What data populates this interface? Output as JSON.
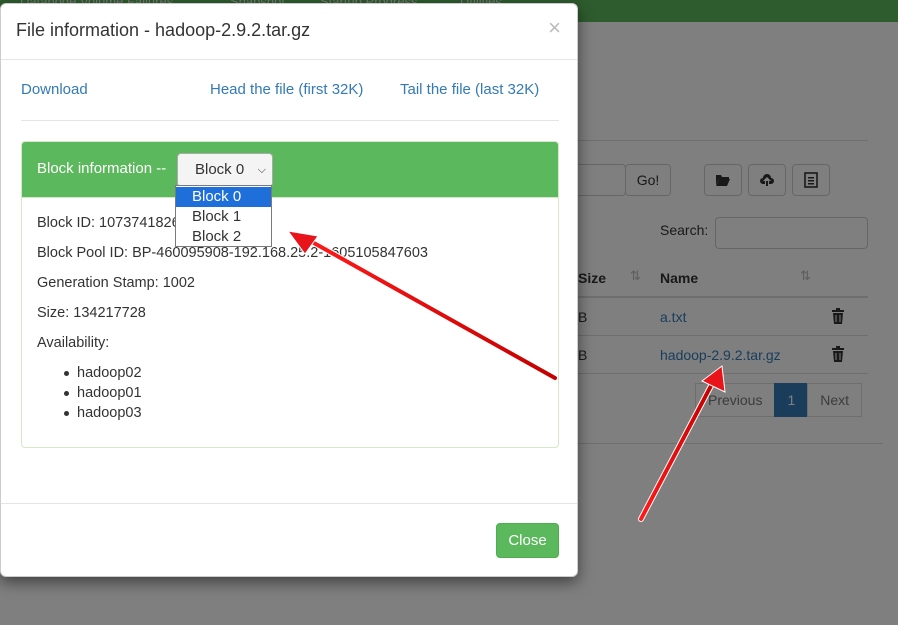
{
  "background": {
    "nav_items": [
      "Datanode Volume Failures",
      "Snapshot",
      "Startup Progress",
      "Utilities"
    ],
    "go_button": "Go!",
    "search_label": "Search:",
    "table": {
      "columns": [
        "Size",
        "Name"
      ],
      "rows": [
        {
          "size": "B",
          "name": "a.txt"
        },
        {
          "size": "B",
          "name": "hadoop-2.9.2.tar.gz"
        }
      ]
    },
    "pagination": {
      "previous": "Previous",
      "current": "1",
      "next": "Next"
    },
    "icons": [
      "folder-open-icon",
      "cloud-upload-icon",
      "list-icon",
      "trash-icon",
      "sort-icon"
    ]
  },
  "modal": {
    "title": "File information - hadoop-2.9.2.tar.gz",
    "close_symbol": "×",
    "links": {
      "download": "Download",
      "head": "Head the file (first 32K)",
      "tail": "Tail the file (last 32K)"
    },
    "panel": {
      "heading": "Block information --",
      "select": {
        "selected": "Block 0",
        "options": [
          "Block 0",
          "Block 1",
          "Block 2"
        ]
      },
      "block_id": "Block ID: 1073741826",
      "block_pool_id": "Block Pool ID: BP-460095908-192.168.25.2-1605105847603",
      "generation_stamp": "Generation Stamp: 1002",
      "size": "Size: 134217728",
      "availability_label": "Availability:",
      "availability": [
        "hadoop02",
        "hadoop01",
        "hadoop03"
      ]
    },
    "close_button": "Close"
  },
  "colors": {
    "success_green": "#5cb85c",
    "link_blue": "#337ab7",
    "select_highlight": "#1e6fd9",
    "annotation_red": "#e8141a"
  }
}
